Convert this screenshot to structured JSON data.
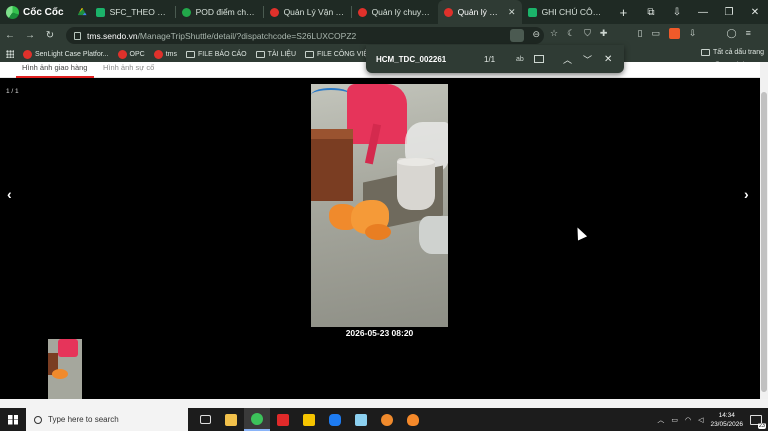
{
  "browser": {
    "brand": "Cốc Cốc",
    "tabs": [
      {
        "title": "",
        "favicon": "google-drive-icon"
      },
      {
        "title": "SFC_THEO DÕI ĐỔI",
        "favicon": "sheets-icon"
      },
      {
        "title": "POD điểm chạm",
        "favicon": "green-circle-icon"
      },
      {
        "title": "Quản Lý Vận Đơn C",
        "favicon": "sendo-icon"
      },
      {
        "title": "Quản lý chuyến xe",
        "favicon": "sendo-icon"
      },
      {
        "title": "Quản lý chuyế",
        "favicon": "sendo-icon",
        "active": true
      },
      {
        "title": "GHI CHÚ CÔNG VI",
        "favicon": "sheets-icon"
      }
    ],
    "new_tab": "+",
    "url_host": "tms.sendo.vn",
    "url_path": "/ManageTripShuttle/detail/?dispatchcode=S26LUXCOPZ2",
    "bookmarks": [
      {
        "label": "SenLight Case Platfor...",
        "type": "site"
      },
      {
        "label": "OPC",
        "type": "site"
      },
      {
        "label": "tms",
        "type": "site"
      },
      {
        "label": "FILE BÁO CÁO",
        "type": "folder"
      },
      {
        "label": "TÀI LIỆU",
        "type": "folder"
      },
      {
        "label": "FILE CÔNG VIỆC",
        "type": "folder"
      }
    ],
    "all_bookmarks": "Tất cả dấu trang"
  },
  "findbar": {
    "query": "HCM_TDC_002261",
    "count": "1/1",
    "match_case": "ab"
  },
  "viewer": {
    "tabs": {
      "active": "Hình ảnh giao hàng",
      "inactive": "Hình ảnh sự cố"
    },
    "counter": "1 / 1",
    "prev": "‹",
    "next": "›",
    "timestamp": "2026-05-23 08:20"
  },
  "taskbar": {
    "search_placeholder": "Type here to search",
    "time": "14:34",
    "date": "23/05/2026",
    "notification_count": "23"
  },
  "colors": {
    "chrome_bg": "#2f3b34",
    "active_subtab": "#e02020",
    "viewer_bg": "#000000"
  }
}
